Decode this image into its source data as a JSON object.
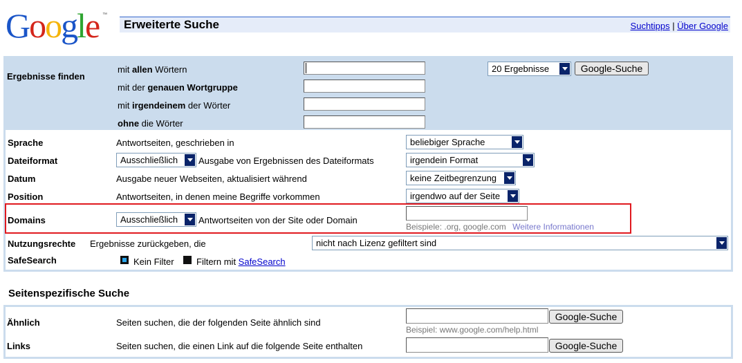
{
  "logo": {
    "letters": [
      "G",
      "o",
      "o",
      "g",
      "l",
      "e"
    ],
    "colors": [
      "#1a55c8",
      "#d4261b",
      "#f5b40a",
      "#1a55c8",
      "#2fa431",
      "#d4261b"
    ],
    "tm": "™"
  },
  "header": {
    "title": "Erweiterte Suche",
    "link_tips": "Suchtipps",
    "separator": "|",
    "link_about": "Über Google"
  },
  "find": {
    "label": "Ergebnisse finden",
    "rows": [
      {
        "pre": "mit ",
        "bold": "allen",
        "post": " Wörtern",
        "value": ""
      },
      {
        "pre": "mit der ",
        "bold": "genauen Wortgruppe",
        "post": "",
        "value": ""
      },
      {
        "pre": "mit ",
        "bold": "irgendeinem",
        "post": " der Wörter",
        "value": ""
      },
      {
        "pre": "",
        "bold": "ohne",
        "post": " die Wörter",
        "value": ""
      }
    ],
    "results_select": "20 Ergebnisse",
    "search_button": "Google-Suche"
  },
  "options": {
    "language": {
      "label": "Sprache",
      "desc": "Antwortseiten, geschrieben in",
      "select": "beliebiger Sprache"
    },
    "fileformat": {
      "label": "Dateiformat",
      "mode": "Ausschließlich",
      "desc": "Ausgabe von Ergebnissen des Dateiformats",
      "select": "irgendein Format"
    },
    "date": {
      "label": "Datum",
      "desc": "Ausgabe neuer Webseiten, aktualisiert während",
      "select": "keine Zeitbegrenzung"
    },
    "position": {
      "label": "Position",
      "desc": "Antwortseiten, in denen meine Begriffe vorkommen",
      "select": "irgendwo auf der Seite"
    },
    "domains": {
      "label": "Domains",
      "mode": "Ausschließlich",
      "desc": "Antwortseiten von der Site oder Domain",
      "value": "",
      "example": "Beispiele: .org, google.com",
      "more_link": "Weitere Informationen"
    },
    "usage": {
      "label": "Nutzungsrechte",
      "desc": "Ergebnisse zurückgeben, die",
      "select": "nicht nach Lizenz gefiltert sind"
    },
    "safesearch": {
      "label": "SafeSearch",
      "opt_off": "Kein Filter",
      "opt_on_pre": "Filtern mit ",
      "opt_on_link": "SafeSearch"
    }
  },
  "site_search": {
    "title": "Seitenspezifische Suche",
    "similar": {
      "label": "Ähnlich",
      "desc": "Seiten suchen, die der folgenden Seite ähnlich sind",
      "value": "",
      "example": "Beispiel: www.google.com/help.html",
      "button": "Google-Suche"
    },
    "links": {
      "label": "Links",
      "desc": "Seiten suchen, die einen Link auf die folgende Seite enthalten",
      "value": "",
      "button": "Google-Suche"
    }
  }
}
